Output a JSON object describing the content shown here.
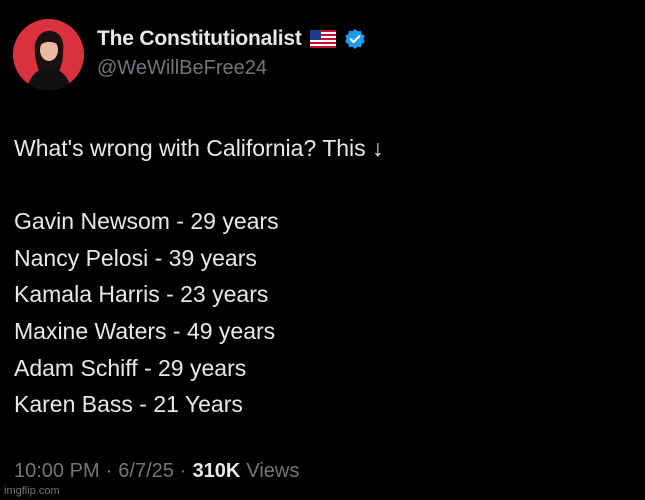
{
  "author": {
    "display_name": "The Constitutionalist",
    "handle": "@WeWillBeFree24",
    "flag_icon": "us-flag-icon",
    "verified_icon": "verified-badge-icon",
    "verified_color": "#1d9bf0",
    "avatar_bg": "#d9323f"
  },
  "post": {
    "intro": "What's wrong with California? This ↓",
    "lines": [
      "Gavin Newsom -  29 years",
      "Nancy Pelosi -  39 years",
      "Kamala Harris - 23 years",
      "Maxine Waters - 49 years",
      "Adam Schiff - 29 years",
      "Karen Bass - 21 Years"
    ]
  },
  "meta": {
    "time": "10:00 PM",
    "sep1": "·",
    "date": "6/7/25",
    "sep2": "·",
    "views_count": "310K",
    "views_label": "Views"
  },
  "watermark": "imgflip.com",
  "colors": {
    "background": "#000000",
    "text": "#e7e9ea",
    "secondary": "#71767b"
  }
}
